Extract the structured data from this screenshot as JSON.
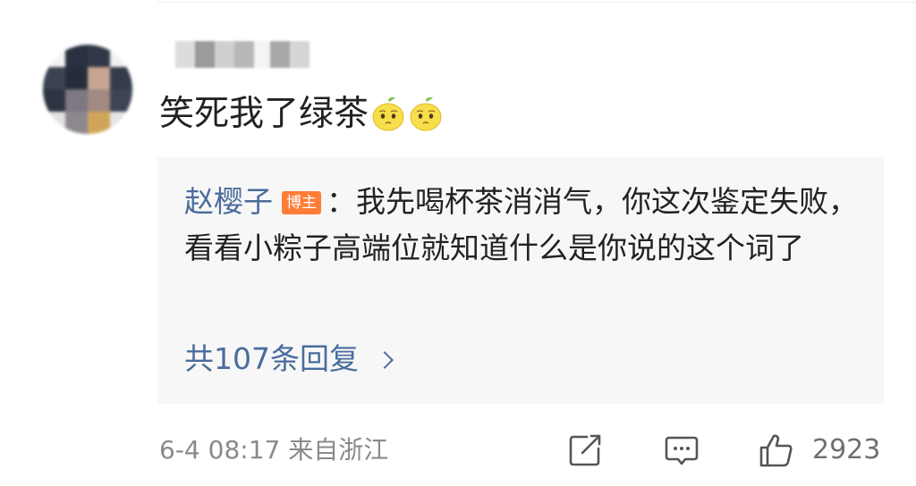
{
  "comment": {
    "text": "笑死我了绿茶",
    "emojis": [
      "lemon-face-icon",
      "lemon-face-icon"
    ]
  },
  "reply": {
    "author": "赵樱子",
    "badge": "博主",
    "separator": "：",
    "text": "我先喝杯茶消消气，你这次鉴定失败，看看小粽子高端位就知道什么是你说的这个词了",
    "count_label": "共107条回复"
  },
  "footer": {
    "timestamp": "6-4 08:17 来自浙江",
    "like_count": "2923"
  },
  "colors": {
    "link": "#4a6c9b",
    "badge": "#ff7d37",
    "text": "#222222",
    "meta": "#8a8a8a",
    "reply_bg": "#f7f7f7"
  },
  "icons": [
    "share-icon",
    "comment-icon",
    "like-icon",
    "chevron-right-icon"
  ]
}
